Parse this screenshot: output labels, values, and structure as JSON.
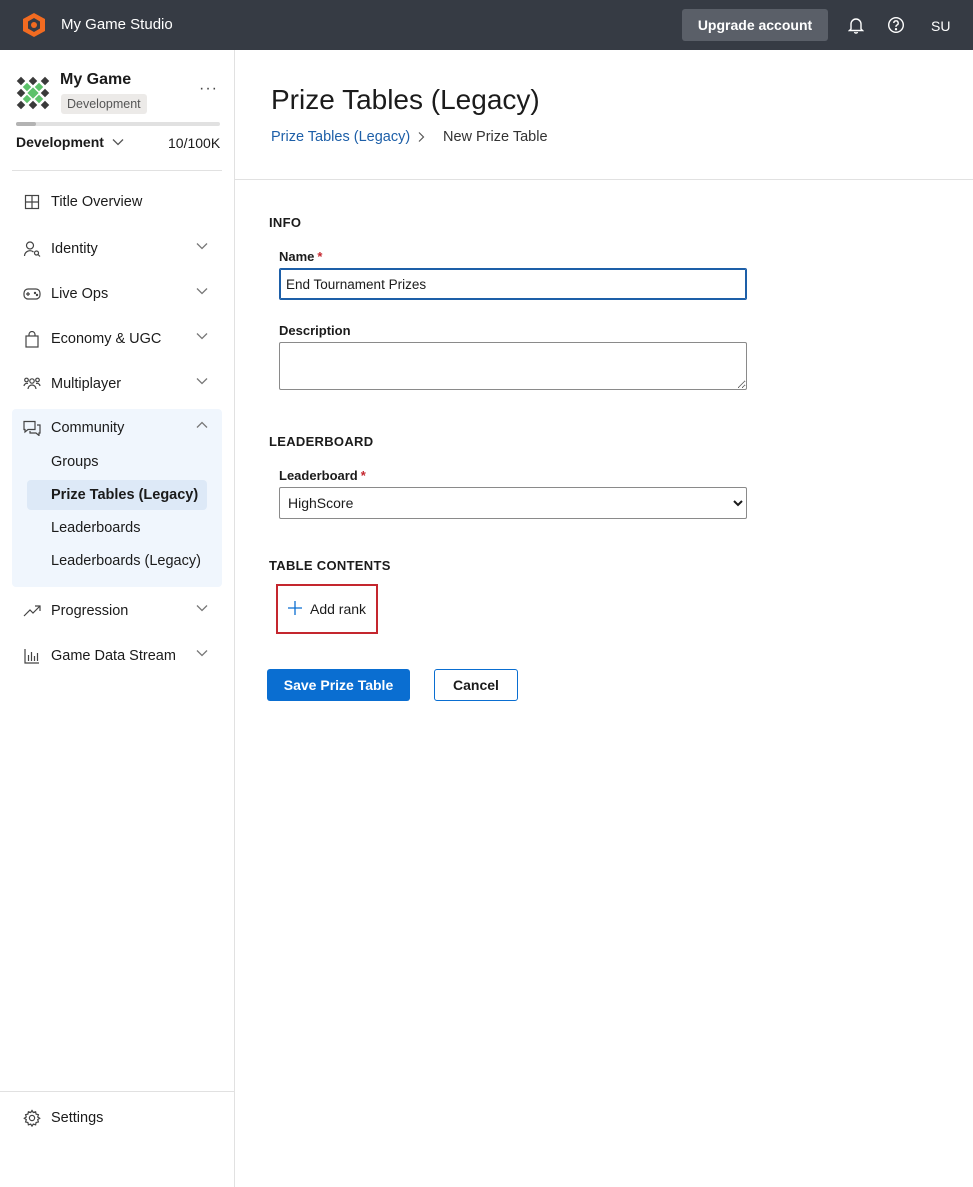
{
  "topbar": {
    "brand_name": "My Game Studio",
    "upgrade_label": "Upgrade account",
    "user_initials": "SU"
  },
  "sidebar": {
    "game_name": "My Game",
    "env_badge": "Development",
    "env_select": "Development",
    "usage_count": "10/100K",
    "usage_fraction": 0.1,
    "items": [
      {
        "label": "Title Overview",
        "icon": "grid-icon"
      },
      {
        "label": "Identity",
        "icon": "identity-icon"
      },
      {
        "label": "Live Ops",
        "icon": "gamepad-icon"
      },
      {
        "label": "Economy & UGC",
        "icon": "shopping-bag-icon"
      },
      {
        "label": "Multiplayer",
        "icon": "people-icon"
      },
      {
        "label": "Community",
        "icon": "chat-icon"
      },
      {
        "label": "Progression",
        "icon": "trend-up-icon"
      },
      {
        "label": "Game Data Stream",
        "icon": "bar-chart-icon"
      }
    ],
    "community_sub": [
      "Groups",
      "Prize Tables (Legacy)",
      "Leaderboards",
      "Leaderboards (Legacy)"
    ],
    "settings_label": "Settings"
  },
  "main": {
    "title": "Prize Tables (Legacy)",
    "breadcrumb_link": "Prize Tables (Legacy)",
    "breadcrumb_current": "New Prize Table",
    "info_head": "INFO",
    "name_label": "Name",
    "name_value": "End Tournament Prizes",
    "description_label": "Description",
    "leaderboard_head": "LEADERBOARD",
    "leaderboard_label": "Leaderboard",
    "leaderboard_value": "HighScore",
    "required_mark": "*",
    "table_contents_head": "TABLE CONTENTS",
    "add_rank_label": "Add rank",
    "save_label": "Save Prize Table",
    "cancel_label": "Cancel"
  },
  "colors": {
    "topbar_bg": "#363b44",
    "accent": "#0a6ed1",
    "link": "#1d5fa8",
    "highlight_border": "#c4262e",
    "brand_orange": "#f26b21"
  }
}
